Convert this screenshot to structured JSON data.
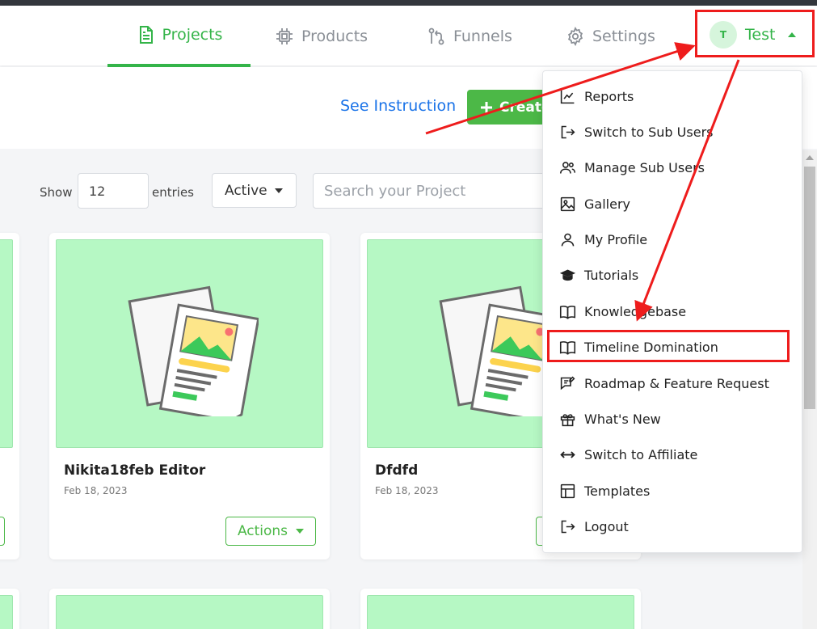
{
  "nav": {
    "projects": "Projects",
    "products": "Products",
    "funnels": "Funnels",
    "settings": "Settings"
  },
  "user": {
    "initial": "T",
    "name": "Test"
  },
  "toolbar": {
    "see_instruction": "See Instruction",
    "create_label": "Create"
  },
  "filters": {
    "show_label": "Show",
    "entries_value": "12",
    "entries_label": "entries",
    "status_value": "Active",
    "search_placeholder": "Search your Project"
  },
  "cards": [
    {
      "title": "Nikita18feb Editor",
      "date": "Feb 18, 2023",
      "actions_label": "Actions"
    },
    {
      "title": "Dfdfd",
      "date": "Feb 18, 2023"
    }
  ],
  "dropdown": {
    "items": [
      {
        "label": "Reports",
        "icon": "chart-line-icon"
      },
      {
        "label": "Switch to Sub Users",
        "icon": "sign-in-icon"
      },
      {
        "label": "Manage Sub Users",
        "icon": "users-icon"
      },
      {
        "label": "Gallery",
        "icon": "image-icon"
      },
      {
        "label": "My Profile",
        "icon": "user-icon"
      },
      {
        "label": "Tutorials",
        "icon": "graduation-cap-icon"
      },
      {
        "label": "Knowledgebase",
        "icon": "book-open-icon"
      },
      {
        "label": "Timeline Domination",
        "icon": "book-open-icon"
      },
      {
        "label": "Roadmap & Feature Request",
        "icon": "message-edit-icon"
      },
      {
        "label": "What's New",
        "icon": "gift-icon"
      },
      {
        "label": "Switch to Affiliate",
        "icon": "arrows-horizontal-icon"
      },
      {
        "label": "Templates",
        "icon": "layout-template-icon"
      },
      {
        "label": "Logout",
        "icon": "logout-icon"
      }
    ]
  },
  "colors": {
    "accent": "#34b449",
    "button_green": "#4cb847",
    "link_blue": "#1a73e8",
    "thumb_green": "#b6f8c4",
    "annotation_red": "#ee1c1c"
  }
}
